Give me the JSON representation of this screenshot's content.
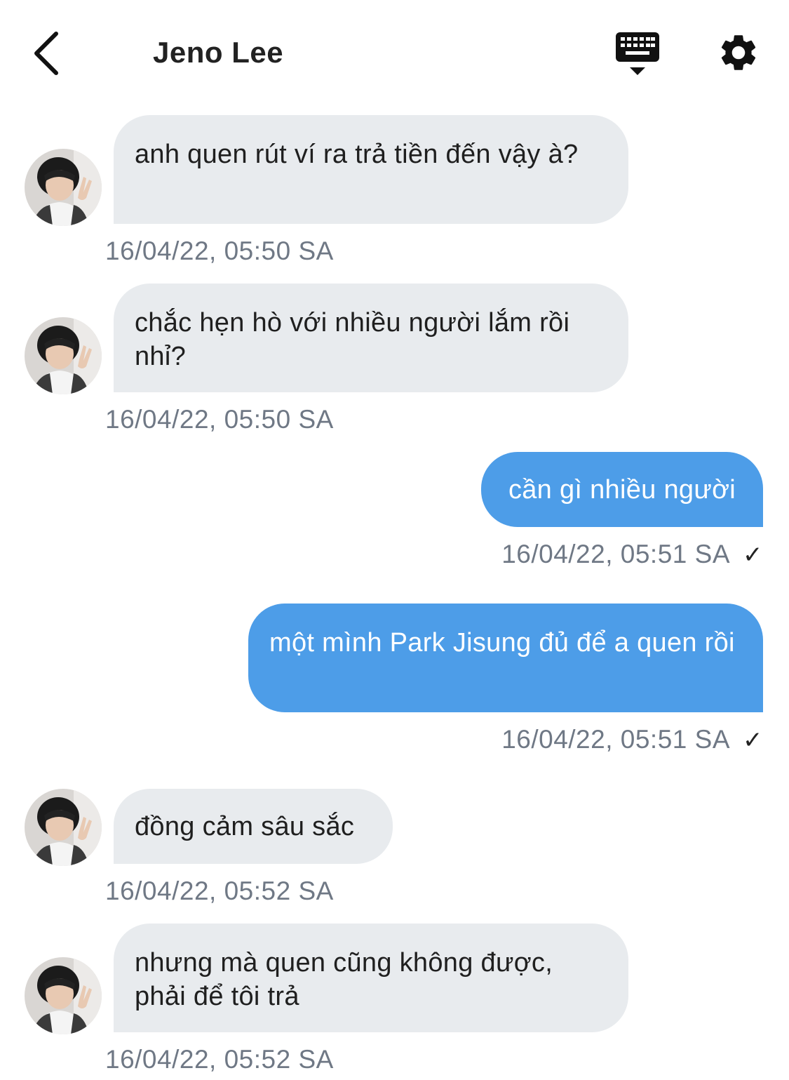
{
  "header": {
    "title": "Jeno Lee",
    "back_icon": "chevron-left-icon",
    "keyboard_icon": "keyboard-hide-icon",
    "settings_icon": "gear-icon"
  },
  "colors": {
    "incoming_bubble": "#e8ebee",
    "outgoing_bubble": "#4d9de8",
    "timestamp": "#6f7885"
  },
  "messages": [
    {
      "direction": "in",
      "text": "anh quen rút ví ra trả tiền đến vậy à?",
      "timestamp": "16/04/22, 05:50 SA"
    },
    {
      "direction": "in",
      "text": "chắc hẹn hò với nhiều người lắm rồi nhỉ?",
      "timestamp": "16/04/22, 05:50 SA"
    },
    {
      "direction": "out",
      "text": "cần gì nhiều người",
      "timestamp": "16/04/22, 05:51 SA",
      "status": "✓"
    },
    {
      "direction": "out",
      "text": "một mình Park Jisung đủ để a quen rồi",
      "timestamp": "16/04/22, 05:51 SA",
      "status": "✓"
    },
    {
      "direction": "in",
      "text": "đồng cảm sâu sắc",
      "timestamp": "16/04/22, 05:52 SA"
    },
    {
      "direction": "in",
      "text": "nhưng mà quen cũng không được, phải để tôi trả",
      "timestamp": "16/04/22, 05:52 SA"
    }
  ]
}
